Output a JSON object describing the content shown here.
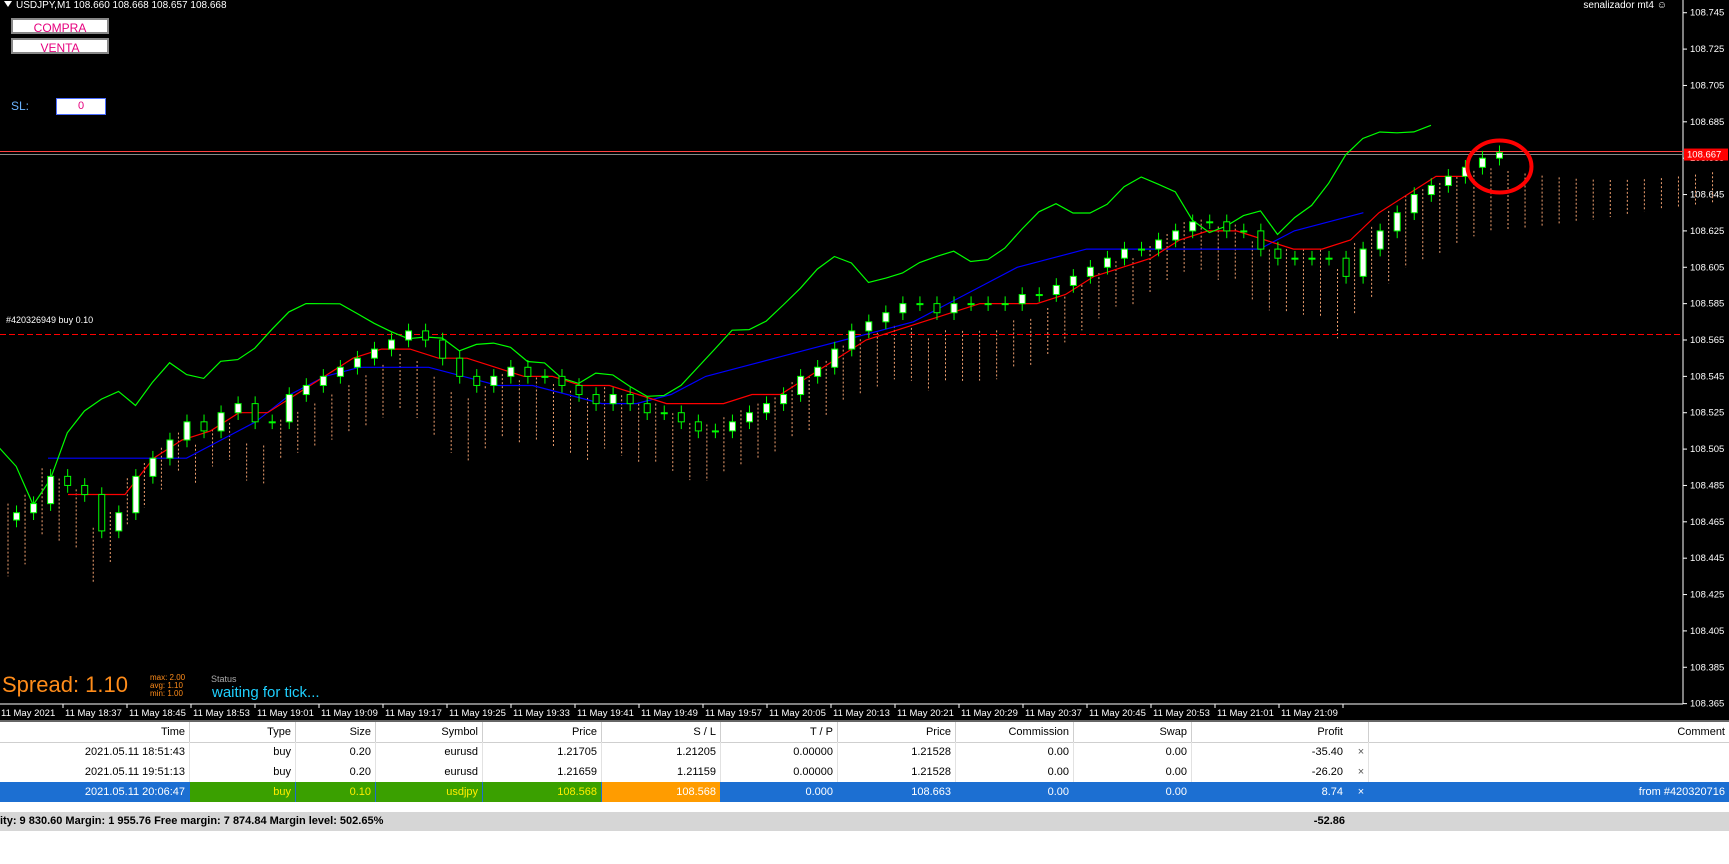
{
  "chart": {
    "header": "USDJPY,M1  108.660 108.668 108.657 108.668",
    "ea_name": "senalizador mt4",
    "buy_button": "COMPRA",
    "sell_button": "VENTA",
    "sl_label": "SL:",
    "sl_value": "0",
    "spread_label": "Spread: 1.10",
    "spread_max": "max:  2.00",
    "spread_avg": "avg:  1.10",
    "spread_min": "min:  1.00",
    "status_label": "Status",
    "status_value": "waiting for tick...",
    "order_tag": "#420326949 buy 0.10",
    "current_price": "108.667",
    "colors": {
      "bull": "#00ff00",
      "tenkan": "#ff0000",
      "kijun": "#0000ff",
      "chikou": "#00ff00",
      "cloud_up": "#f0a070",
      "cloud_down": "#ffffff",
      "order_line": "#ff0000",
      "highlight": "#ff0000"
    }
  },
  "chart_data": {
    "type": "candlestick",
    "symbol": "USDJPY",
    "timeframe": "M1",
    "y_ticks": [
      "108.745",
      "108.725",
      "108.705",
      "108.685",
      "108.665",
      "108.645",
      "108.625",
      "108.605",
      "108.585",
      "108.565",
      "108.545",
      "108.525",
      "108.505",
      "108.485",
      "108.465",
      "108.445",
      "108.425",
      "108.405",
      "108.385",
      "108.365"
    ],
    "ylim": [
      108.356,
      108.752
    ],
    "x_ticks": [
      "11 May 2021",
      "11 May 18:37",
      "11 May 18:45",
      "11 May 18:53",
      "11 May 19:01",
      "11 May 19:09",
      "11 May 19:17",
      "11 May 19:25",
      "11 May 19:33",
      "11 May 19:41",
      "11 May 19:49",
      "11 May 19:57",
      "11 May 20:05",
      "11 May 20:13",
      "11 May 20:21",
      "11 May 20:29",
      "11 May 20:37",
      "11 May 20:45",
      "11 May 20:53",
      "11 May 21:01",
      "11 May 21:09"
    ],
    "order_level": 108.568,
    "current_price": 108.667,
    "close_series": [
      108.47,
      108.475,
      108.49,
      108.485,
      108.48,
      108.46,
      108.47,
      108.49,
      108.5,
      108.51,
      108.52,
      108.515,
      108.525,
      108.53,
      108.52,
      108.52,
      108.535,
      108.54,
      108.545,
      108.55,
      108.555,
      108.56,
      108.565,
      108.57,
      108.565,
      108.555,
      108.545,
      108.54,
      108.545,
      108.55,
      108.545,
      108.545,
      108.54,
      108.535,
      108.53,
      108.535,
      108.53,
      108.525,
      108.525,
      108.52,
      108.515,
      108.515,
      108.52,
      108.525,
      108.53,
      108.535,
      108.545,
      108.55,
      108.56,
      108.57,
      108.575,
      108.58,
      108.585,
      108.585,
      108.58,
      108.585,
      108.585,
      108.585,
      108.585,
      108.59,
      108.59,
      108.595,
      108.6,
      108.605,
      108.61,
      108.615,
      108.615,
      108.62,
      108.625,
      108.63,
      108.63,
      108.625,
      108.625,
      108.615,
      108.61,
      108.61,
      108.61,
      108.61,
      108.6,
      108.615,
      108.625,
      108.635,
      108.645,
      108.65,
      108.655,
      108.66,
      108.665,
      108.668
    ],
    "tenkan_series": [
      108.48,
      108.48,
      108.48,
      108.5,
      108.51,
      108.515,
      108.525,
      108.525,
      108.535,
      108.545,
      108.555,
      108.56,
      108.56,
      108.555,
      108.555,
      108.55,
      108.545,
      108.545,
      108.54,
      108.54,
      108.535,
      108.53,
      108.53,
      108.53,
      108.535,
      108.535,
      108.545,
      108.555,
      108.565,
      108.57,
      108.575,
      108.58,
      108.585,
      108.585,
      108.585,
      108.59,
      108.6,
      108.605,
      108.61,
      108.62,
      108.625,
      108.625,
      108.62,
      108.615,
      108.615,
      108.62,
      108.635,
      108.645,
      108.655,
      108.655
    ],
    "kijun_series": [
      108.5,
      108.5,
      108.5,
      108.5,
      108.5,
      108.51,
      108.52,
      108.535,
      108.545,
      108.55,
      108.55,
      108.55,
      108.545,
      108.54,
      108.54,
      108.535,
      108.53,
      108.53,
      108.535,
      108.545,
      108.55,
      108.555,
      108.56,
      108.565,
      108.57,
      108.575,
      108.585,
      108.595,
      108.605,
      108.61,
      108.615,
      108.615,
      108.615,
      108.615,
      108.615,
      108.615,
      108.625,
      108.63,
      108.635
    ]
  },
  "terminal": {
    "headers": [
      "Time",
      "Type",
      "Size",
      "Symbol",
      "Price",
      "S / L",
      "T / P",
      "Price",
      "Commission",
      "Swap",
      "Profit",
      "Comment"
    ],
    "rows": [
      {
        "time": "2021.05.11 18:51:43",
        "type": "buy",
        "size": "0.20",
        "symbol": "eurusd",
        "price": "1.21705",
        "sl": "1.21205",
        "tp": "0.00000",
        "cur": "1.21528",
        "commission": "0.00",
        "swap": "0.00",
        "profit": "-35.40",
        "comment": "",
        "selected": false
      },
      {
        "time": "2021.05.11 19:51:13",
        "type": "buy",
        "size": "0.20",
        "symbol": "eurusd",
        "price": "1.21659",
        "sl": "1.21159",
        "tp": "0.00000",
        "cur": "1.21528",
        "commission": "0.00",
        "swap": "0.00",
        "profit": "-26.20",
        "comment": "",
        "selected": false
      },
      {
        "time": "2021.05.11 20:06:47",
        "type": "buy",
        "size": "0.10",
        "symbol": "usdjpy",
        "price": "108.568",
        "sl": "108.568",
        "tp": "0.000",
        "cur": "108.663",
        "commission": "0.00",
        "swap": "0.00",
        "profit": "8.74",
        "comment": "from #420320716",
        "selected": true
      }
    ],
    "close_glyph": "×",
    "summary_account": "ity: 9 830.60  Margin: 1 955.76  Free margin: 7 874.84  Margin level: 502.65%",
    "summary_total": "-52.86"
  }
}
